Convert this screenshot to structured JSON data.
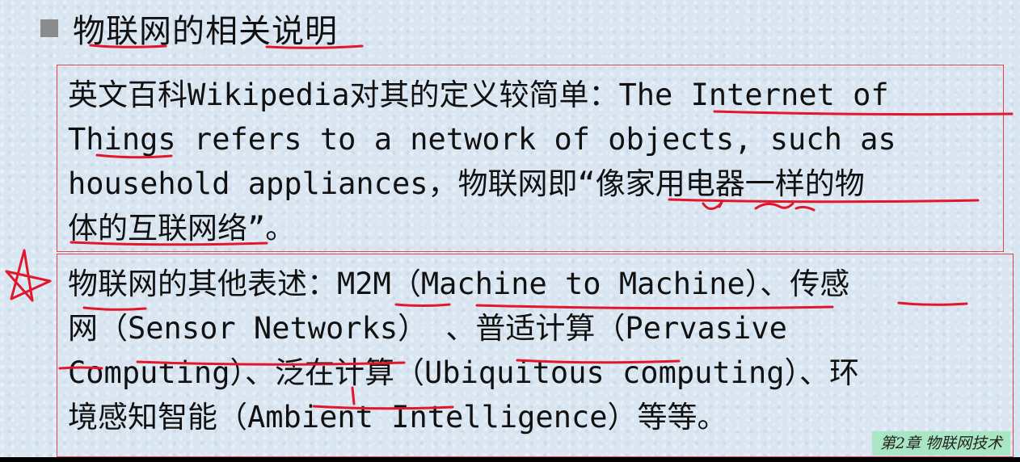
{
  "heading": "物联网的相关说明",
  "paragraph1": {
    "lines": [
      "英文百科Wikipedia对其的定义较简单：The Internet of",
      "Things refers to a network of objects, such as",
      "household appliances，物联网即“像家用电器一样的物",
      "体的互联网络”。"
    ]
  },
  "paragraph2": {
    "lines": [
      "物联网的其他表述：M2M（Machine to Machine）、传感",
      "网（Sensor Networks） 、普适计算（Pervasive",
      "Computing）、泛在计算（Ubiquitous computing）、环",
      "境感知智能（Ambient Intelligence）等等。"
    ]
  },
  "chapter_tag": "第2章 物联网技术",
  "annotation_color": "#e2172b"
}
